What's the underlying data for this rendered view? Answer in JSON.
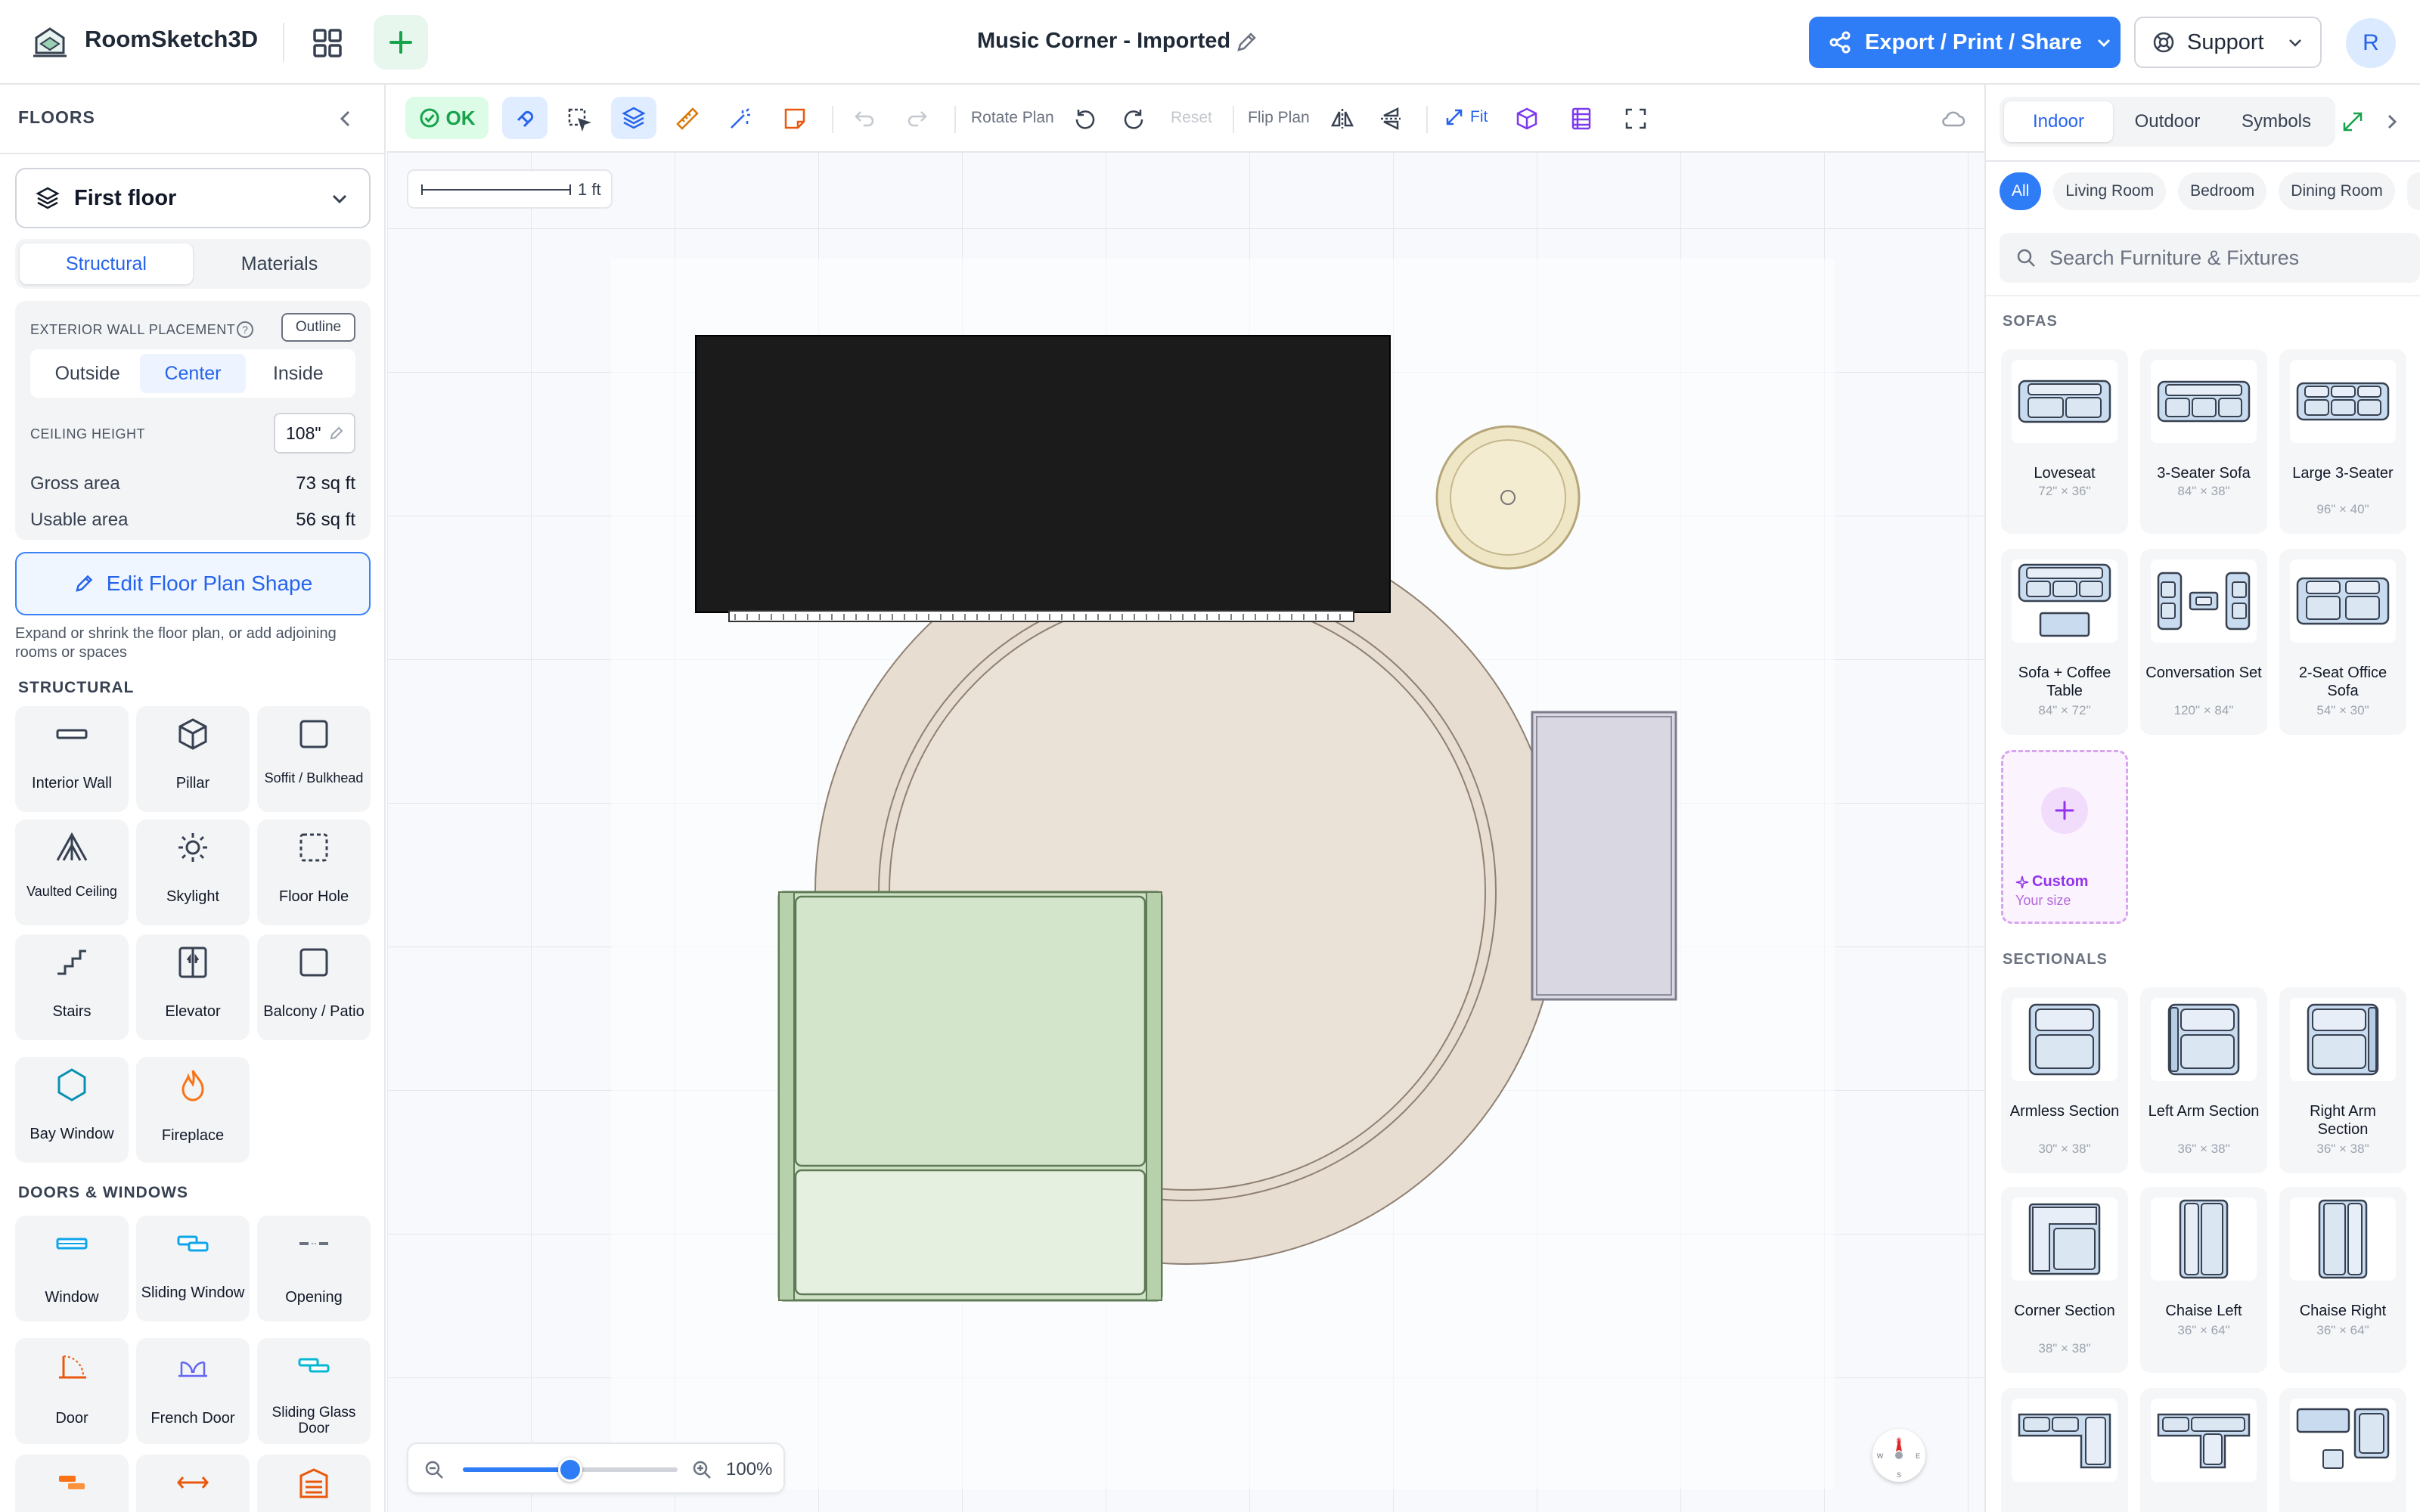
{
  "header": {
    "app_name": "RoomSketch3D",
    "project_title": "Music Corner - Imported",
    "export_label": "Export / Print / Share",
    "support_label": "Support",
    "avatar_initial": "R",
    "brand_color": "#2f7df6"
  },
  "left": {
    "title": "FLOORS",
    "floor_name": "First floor",
    "tabs": [
      "Structural",
      "Materials"
    ],
    "wall_placement_label": "EXTERIOR WALL PLACEMENT",
    "outline_label": "Outline",
    "wall_options": [
      "Outside",
      "Center",
      "Inside"
    ],
    "ceiling_label": "CEILING HEIGHT",
    "ceiling_value": "108\"",
    "gross_label": "Gross area",
    "gross_value": "73 sq ft",
    "usable_label": "Usable area",
    "usable_value": "56 sq ft",
    "edit_shape_label": "Edit Floor Plan Shape",
    "edit_help": "Expand or shrink the floor plan, or add adjoining rooms or spaces",
    "structural_title": "STRUCTURAL",
    "structural_items": [
      "Interior Wall",
      "Pillar",
      "Soffit / Bulkhead",
      "Vaulted Ceiling",
      "Skylight",
      "Floor Hole",
      "Stairs",
      "Elevator",
      "Balcony / Patio",
      "Bay Window",
      "Fireplace"
    ],
    "doors_title": "DOORS & WINDOWS",
    "door_items": [
      "Window",
      "Sliding Window",
      "Opening",
      "Door",
      "French Door",
      "Sliding Glass Door"
    ]
  },
  "toolbar": {
    "status": "OK",
    "rotate_label": "Rotate Plan",
    "reset_label": "Reset",
    "flip_label": "Flip Plan",
    "fit_label": "Fit"
  },
  "canvas": {
    "scale_label": "1 ft",
    "zoom_value": "100%",
    "zoom_level": 0.5,
    "compass": [
      "N",
      "W",
      "E",
      "S"
    ]
  },
  "right": {
    "tabs": [
      "Indoor",
      "Outdoor",
      "Symbols"
    ],
    "categories": [
      "All",
      "Living Room",
      "Bedroom",
      "Dining Room"
    ],
    "search_placeholder": "Search Furniture & Fixtures",
    "sofas_title": "SOFAS",
    "sofas": [
      {
        "name": "Loveseat",
        "dims": "72\" × 36\""
      },
      {
        "name": "3-Seater Sofa",
        "dims": "84\" × 38\""
      },
      {
        "name": "Large 3-Seater",
        "dims": "96\" × 40\""
      },
      {
        "name": "Sofa + Coffee Table",
        "dims": "84\" × 72\""
      },
      {
        "name": "Conversation Set",
        "dims": "120\" × 84\""
      },
      {
        "name": "2-Seat Office Sofa",
        "dims": "54\" × 30\""
      }
    ],
    "custom_label": "Custom",
    "custom_sub": "Your size",
    "sectionals_title": "SECTIONALS",
    "sectionals": [
      {
        "name": "Armless Section",
        "dims": "30\" × 38\""
      },
      {
        "name": "Left Arm Section",
        "dims": "36\" × 38\""
      },
      {
        "name": "Right Arm Section",
        "dims": "36\" × 38\""
      },
      {
        "name": "Corner Section",
        "dims": "38\" × 38\""
      },
      {
        "name": "Chaise Left",
        "dims": "36\" × 64\""
      },
      {
        "name": "Chaise Right",
        "dims": "36\" × 64\""
      }
    ]
  }
}
